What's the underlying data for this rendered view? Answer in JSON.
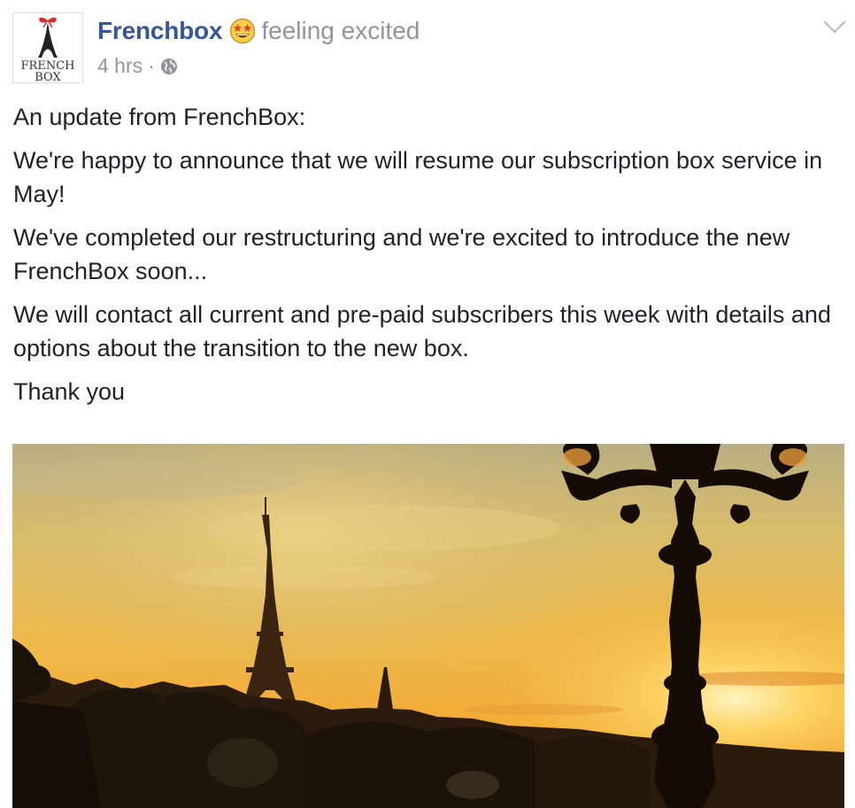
{
  "post": {
    "author": "Frenchbox",
    "feeling": "feeling excited",
    "feeling_icon": "star-struck-emoji",
    "timestamp": "4 hrs",
    "separator": "·",
    "audience_icon": "globe-icon",
    "avatar": {
      "logo_line1": "FRENCH",
      "logo_line2": "BOX"
    },
    "paragraphs": [
      "An update from FrenchBox:",
      "We're happy to announce that we will resume our subscription box service in May!",
      "We've completed our restructuring and we're excited to introduce the new FrenchBox soon...",
      "We will contact all current and pre-paid subscribers this week with details and options about the transition to the new box.",
      "Thank you"
    ],
    "photo": {
      "subject": "Eiffel Tower at sunset with ornate lamppost silhouette"
    }
  },
  "colors": {
    "author_link": "#365899",
    "meta_gray": "#90949c",
    "body_text": "#1d2129",
    "sky_top": "#c9b77e",
    "sky_glow": "#f7c34a",
    "silhouette": "#1a1208"
  }
}
